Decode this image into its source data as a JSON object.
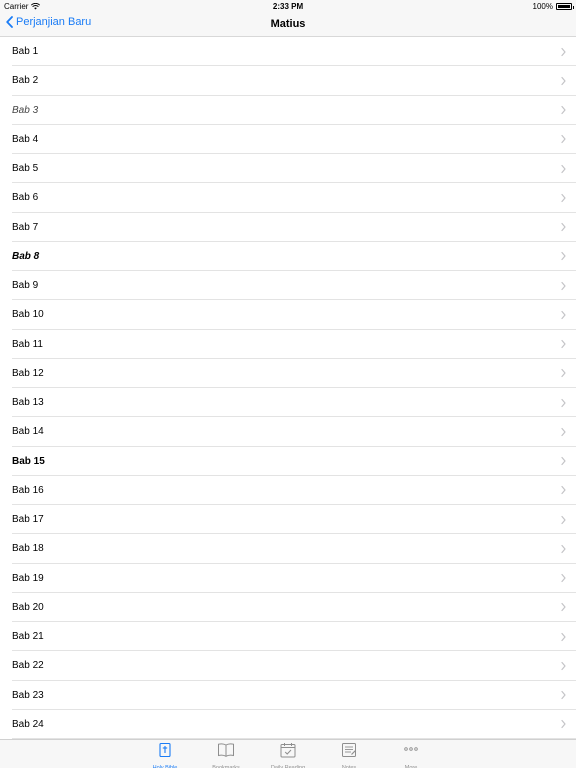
{
  "status": {
    "carrier": "Carrier",
    "time": "2:33 PM",
    "battery": "100%"
  },
  "nav": {
    "back_label": "Perjanjian Baru",
    "title": "Matius"
  },
  "chapters": [
    {
      "label": "Bab 1",
      "style": "normal"
    },
    {
      "label": "Bab 2",
      "style": "normal"
    },
    {
      "label": "Bab 3",
      "style": "italic"
    },
    {
      "label": "Bab 4",
      "style": "normal"
    },
    {
      "label": "Bab 5",
      "style": "normal"
    },
    {
      "label": "Bab 6",
      "style": "normal"
    },
    {
      "label": "Bab 7",
      "style": "normal"
    },
    {
      "label": "Bab 8",
      "style": "bold-italic"
    },
    {
      "label": "Bab 9",
      "style": "normal"
    },
    {
      "label": "Bab 10",
      "style": "normal"
    },
    {
      "label": "Bab 11",
      "style": "normal"
    },
    {
      "label": "Bab 12",
      "style": "normal"
    },
    {
      "label": "Bab 13",
      "style": "normal"
    },
    {
      "label": "Bab 14",
      "style": "normal"
    },
    {
      "label": "Bab 15",
      "style": "bold"
    },
    {
      "label": "Bab 16",
      "style": "normal"
    },
    {
      "label": "Bab 17",
      "style": "normal"
    },
    {
      "label": "Bab 18",
      "style": "normal"
    },
    {
      "label": "Bab 19",
      "style": "normal"
    },
    {
      "label": "Bab 20",
      "style": "normal"
    },
    {
      "label": "Bab 21",
      "style": "normal"
    },
    {
      "label": "Bab 22",
      "style": "normal"
    },
    {
      "label": "Bab 23",
      "style": "normal"
    },
    {
      "label": "Bab 24",
      "style": "normal"
    }
  ],
  "tabs": [
    {
      "label": "Holy Bible",
      "icon": "bible-icon",
      "active": true
    },
    {
      "label": "Bookmarks",
      "icon": "book-icon",
      "active": false
    },
    {
      "label": "Daily Reading",
      "icon": "calendar-check-icon",
      "active": false
    },
    {
      "label": "Notes",
      "icon": "notes-icon",
      "active": false
    },
    {
      "label": "More",
      "icon": "more-icon",
      "active": false
    }
  ],
  "colors": {
    "accent": "#1a7cf6",
    "inactive": "#8e8e8e",
    "separator": "#e3e3e3"
  }
}
